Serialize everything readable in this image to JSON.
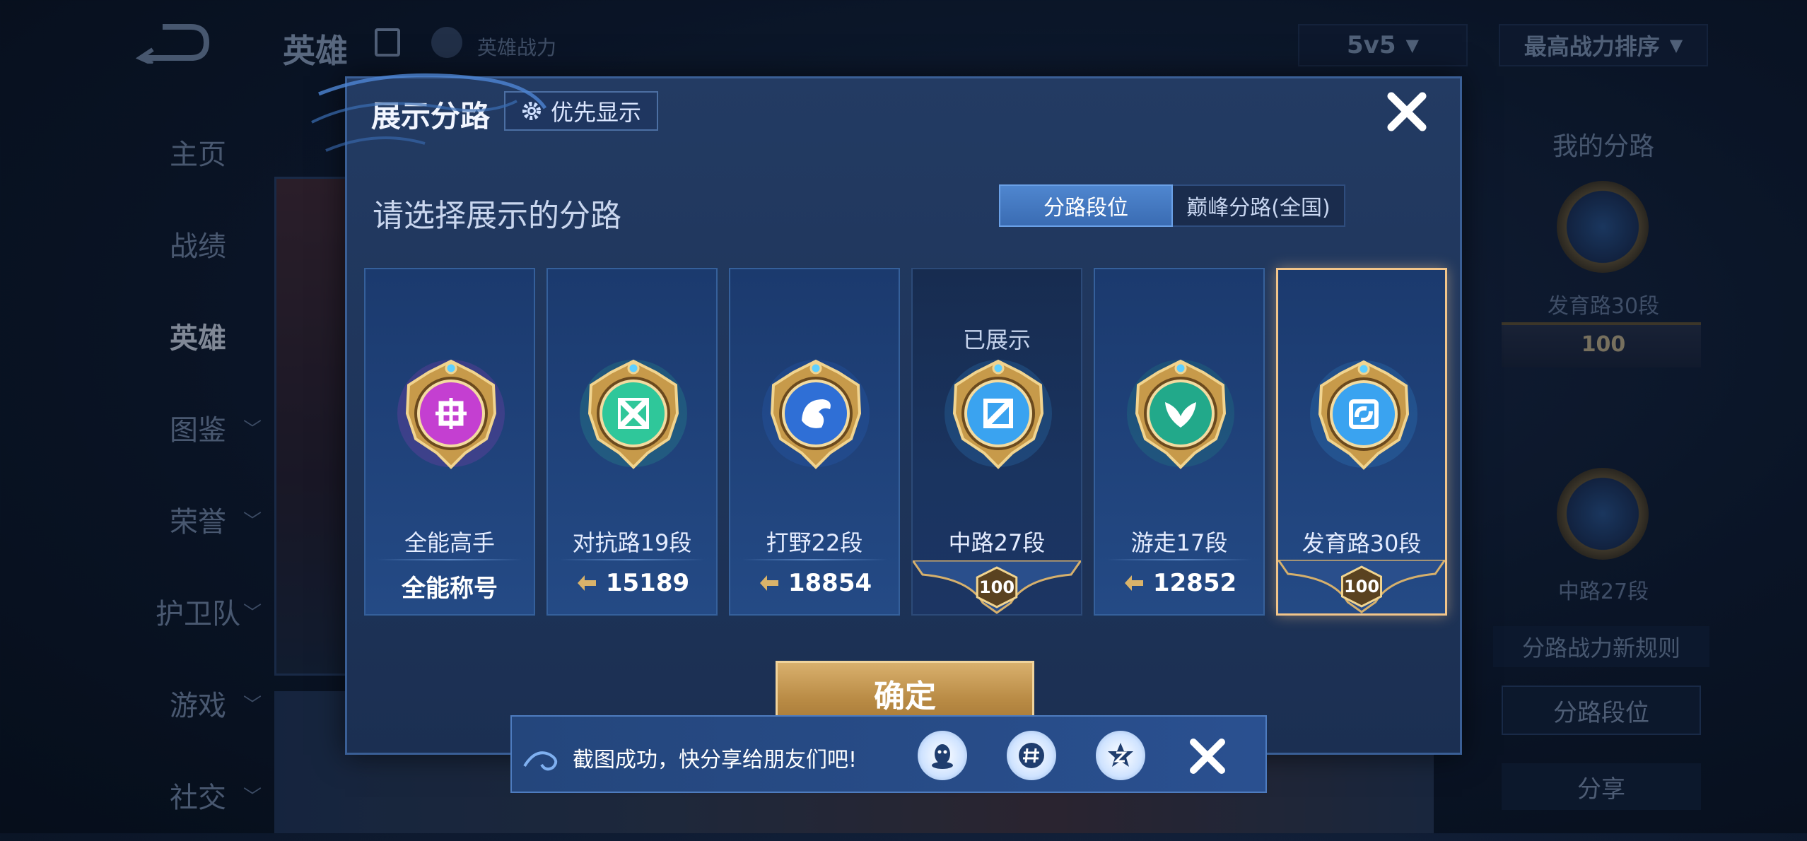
{
  "background": {
    "title": "英雄",
    "power_label": "英雄战力",
    "mode_select": "5v5",
    "sort_select": "最高战力排序",
    "nav": [
      {
        "label": "主页",
        "chevron": false,
        "active": false
      },
      {
        "label": "战绩",
        "chevron": false,
        "active": false
      },
      {
        "label": "英雄",
        "chevron": false,
        "active": true
      },
      {
        "label": "图鉴",
        "chevron": true,
        "active": false
      },
      {
        "label": "荣誉",
        "chevron": true,
        "active": false
      },
      {
        "label": "护卫队",
        "chevron": true,
        "active": false
      },
      {
        "label": "游戏",
        "chevron": true,
        "active": false
      },
      {
        "label": "社交",
        "chevron": true,
        "active": false
      }
    ],
    "right_panel": {
      "title": "我的分路",
      "lane1": "发育路30段",
      "lane1_rank": "100",
      "lane2": "中路27段",
      "rule_label": "分路战力新规则",
      "lane_rank_button": "分路段位",
      "share_button": "分享"
    }
  },
  "modal": {
    "title": "展示分路",
    "priority_button": "优先显示",
    "subtitle": "请选择展示的分路",
    "tabs": [
      {
        "label": "分路段位",
        "active": true
      },
      {
        "label": "巅峰分路(全国)",
        "active": false
      }
    ],
    "cards": [
      {
        "name": "全能高手",
        "value": "全能称号",
        "kind": "title",
        "badge": "all-round-badge",
        "color": "#c43fd1",
        "shown": false,
        "selected": false
      },
      {
        "name": "对抗路19段",
        "value": "15189",
        "kind": "power",
        "badge": "clash-lane-badge",
        "color": "#2fc79a",
        "shown": false,
        "selected": false
      },
      {
        "name": "打野22段",
        "value": "18854",
        "kind": "power",
        "badge": "jungle-badge",
        "color": "#2f6fd6",
        "shown": false,
        "selected": false
      },
      {
        "name": "中路27段",
        "value": "100",
        "kind": "rank",
        "badge": "mid-lane-badge",
        "color": "#3aa3f0",
        "shown": true,
        "shown_label": "已展示",
        "selected": false
      },
      {
        "name": "游走17段",
        "value": "12852",
        "kind": "power",
        "badge": "roam-badge",
        "color": "#22a98a",
        "shown": false,
        "selected": false
      },
      {
        "name": "发育路30段",
        "value": "100",
        "kind": "rank",
        "badge": "farm-lane-badge",
        "color": "#3aa3f0",
        "shown": false,
        "selected": true
      }
    ],
    "confirm_button": "确定"
  },
  "toast": {
    "message": "截图成功，快分享给朋友们吧!",
    "share_targets": [
      "qq-icon",
      "wechat-moments-icon",
      "qzone-icon"
    ]
  },
  "colors": {
    "accent_gold": "#f2c58a",
    "tab_active": "#4f86cf",
    "panel_bg": "#233b63"
  }
}
